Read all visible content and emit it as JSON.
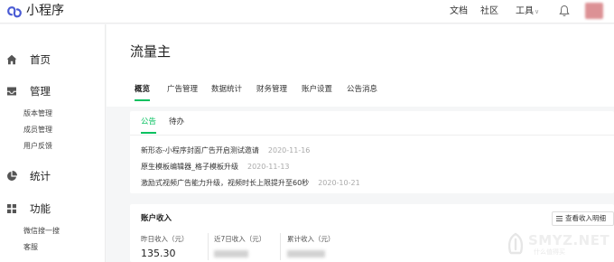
{
  "topbar": {
    "app_name": "小程序",
    "links": [
      "文档",
      "社区",
      "工具"
    ]
  },
  "sidebar": {
    "sections": [
      {
        "label": "首页",
        "icon": "home-icon",
        "items": []
      },
      {
        "label": "管理",
        "icon": "inbox-icon",
        "items": [
          "版本管理",
          "成员管理",
          "用户反馈"
        ]
      },
      {
        "label": "统计",
        "icon": "pie-chart-icon",
        "items": []
      },
      {
        "label": "功能",
        "icon": "grid-icon",
        "items": [
          "微信搜一搜",
          "客服"
        ]
      }
    ]
  },
  "main": {
    "title": "流量主",
    "tabs": [
      "概览",
      "广告管理",
      "数据统计",
      "财务管理",
      "账户设置",
      "公告消息"
    ],
    "active_tab": "概览"
  },
  "notices": {
    "tabs": [
      "公告",
      "待办"
    ],
    "items": [
      {
        "text": "新形态-小程序封面广告开启测试邀请",
        "date": "2020-11-16"
      },
      {
        "text": "原生模板编辑器_格子模板升级",
        "date": "2020-11-13"
      },
      {
        "text": "激励式视频广告能力升级，视频时长上限提升至60秒",
        "date": "2020-10-21"
      }
    ]
  },
  "income": {
    "title": "账户收入",
    "detail_button": "查看收入明细",
    "stats": [
      {
        "label": "昨日收入（元）",
        "value": "135.30"
      },
      {
        "label": "近7日收入（元）",
        "value": ""
      },
      {
        "label": "累计收入（元）",
        "value": ""
      }
    ]
  },
  "watermark": {
    "text": "SMYZ.NET",
    "subtext": "什么值得买"
  },
  "colors": {
    "accent": "#07c160",
    "logo": "#4a5bd4",
    "background": "#f5f6f7"
  }
}
